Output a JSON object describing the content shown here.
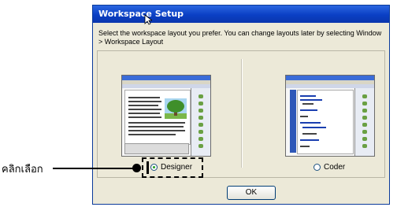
{
  "dialog": {
    "title": "Workspace Setup",
    "instructions": "Select the workspace layout you prefer. You can change layouts later by selecting Window > Workspace Layout",
    "options": [
      {
        "label": "Designer",
        "selected": true
      },
      {
        "label": "Coder",
        "selected": false
      }
    ],
    "ok_label": "OK"
  },
  "annotation": {
    "label": "คลิกเลือก"
  },
  "colors": {
    "titlebar": "#0a3fc4",
    "dialog_bg": "#ece9d8",
    "selected_radio": "#21a121"
  }
}
